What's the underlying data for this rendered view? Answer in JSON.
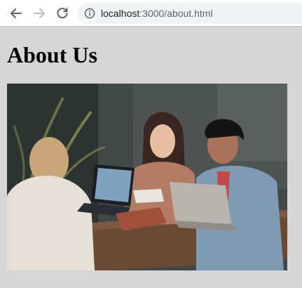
{
  "browser": {
    "url_host": "localhost",
    "url_path": ":3000/about.html",
    "icons": {
      "back": "arrow-left-icon",
      "forward": "arrow-right-icon",
      "reload": "reload-icon",
      "site_info": "info-icon"
    }
  },
  "page": {
    "title": "About Us",
    "hero_image": {
      "subject": "photo"
    }
  },
  "colors": {
    "page_background": "#d6d6d6",
    "chrome_background": "#ffffff",
    "address_background": "#f1f3f4"
  }
}
